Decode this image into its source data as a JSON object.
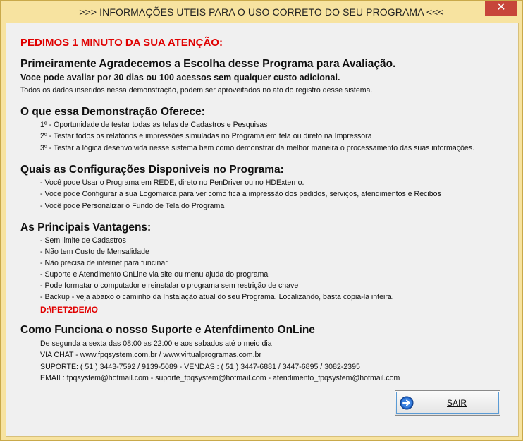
{
  "window": {
    "title": ">>> INFORMAÇÕES UTEIS PARA O USO CORRETO DO SEU PROGRAMA <<<",
    "close_glyph": "✕"
  },
  "attention": "PEDIMOS 1 MINUTO DA SUA ATENÇÃO:",
  "intro": {
    "heading": "Primeiramente Agradecemos a Escolha desse Programa para Avaliação.",
    "subheading": "Voce pode avaliar por 30 dias ou 100 acessos sem qualquer custo adicional.",
    "note": "Todos os dados inseridos nessa demonstração, podem ser aproveitados no ato do registro desse sistema."
  },
  "offers": {
    "heading": "O que essa Demonstração Oferece:",
    "items": [
      "1º - Oportunidade de testar todas as telas de Cadastros e Pesquisas",
      "2º - Testar todos os relatórios e impressões simuladas no Programa em tela ou direto na Impressora",
      "3º - Testar a lógica desenvolvida nesse sistema bem como demonstrar da melhor maneira o processamento das suas informações."
    ]
  },
  "config": {
    "heading": "Quais as Configurações Disponiveis no Programa:",
    "items": [
      "- Você pode Usar o Programa em REDE, direto no PenDriver ou no HDExterno.",
      "- Voce pode Configurar a sua Logomarca para ver como fica a impressão dos pedidos, serviços, atendimentos e Recibos",
      "- Você pode Personalizar o Fundo de Tela do Programa"
    ]
  },
  "advantages": {
    "heading": "As Principais Vantagens:",
    "items": [
      "- Sem limite de Cadastros",
      "- Não tem Custo de Mensalidade",
      "- Não precisa de internet para funcinar",
      "- Suporte e Atendimento OnLine via site ou menu ajuda do programa",
      "- Pode formatar o computador e reinstalar o programa sem restrição de chave",
      "- Backup - veja abaixo o caminho da Instalação atual do seu Programa. Localizando, basta copia-la inteira."
    ],
    "install_path": "D:\\PET2DEMO"
  },
  "support": {
    "heading": "Como Funciona o nosso Suporte e Atenfdimento OnLine",
    "lines": [
      "De segunda a sexta das 08:00 as 22:00 e aos sabados até o meio dia",
      "VIA CHAT - www.fpqsystem.com.br / www.virtualprogramas.com.br",
      "SUPORTE: ( 51 ) 3443-7592 / 9139-5089  - VENDAS : ( 51 ) 3447-6881 / 3447-6895 / 3082-2395",
      "EMAIL: fpqsystem@hotmail.com - suporte_fpqsystem@hotmail.com - atendimento_fpqsystem@hotmail.com"
    ]
  },
  "exit_button": {
    "label": "SAIR",
    "icon": "arrow-right-circle-icon"
  },
  "colors": {
    "frame": "#f7e3a0",
    "client": "#f0f0f0",
    "highlight_red": "#e00000",
    "close_button": "#c7453a",
    "icon_blue": "#1f5fbf"
  }
}
